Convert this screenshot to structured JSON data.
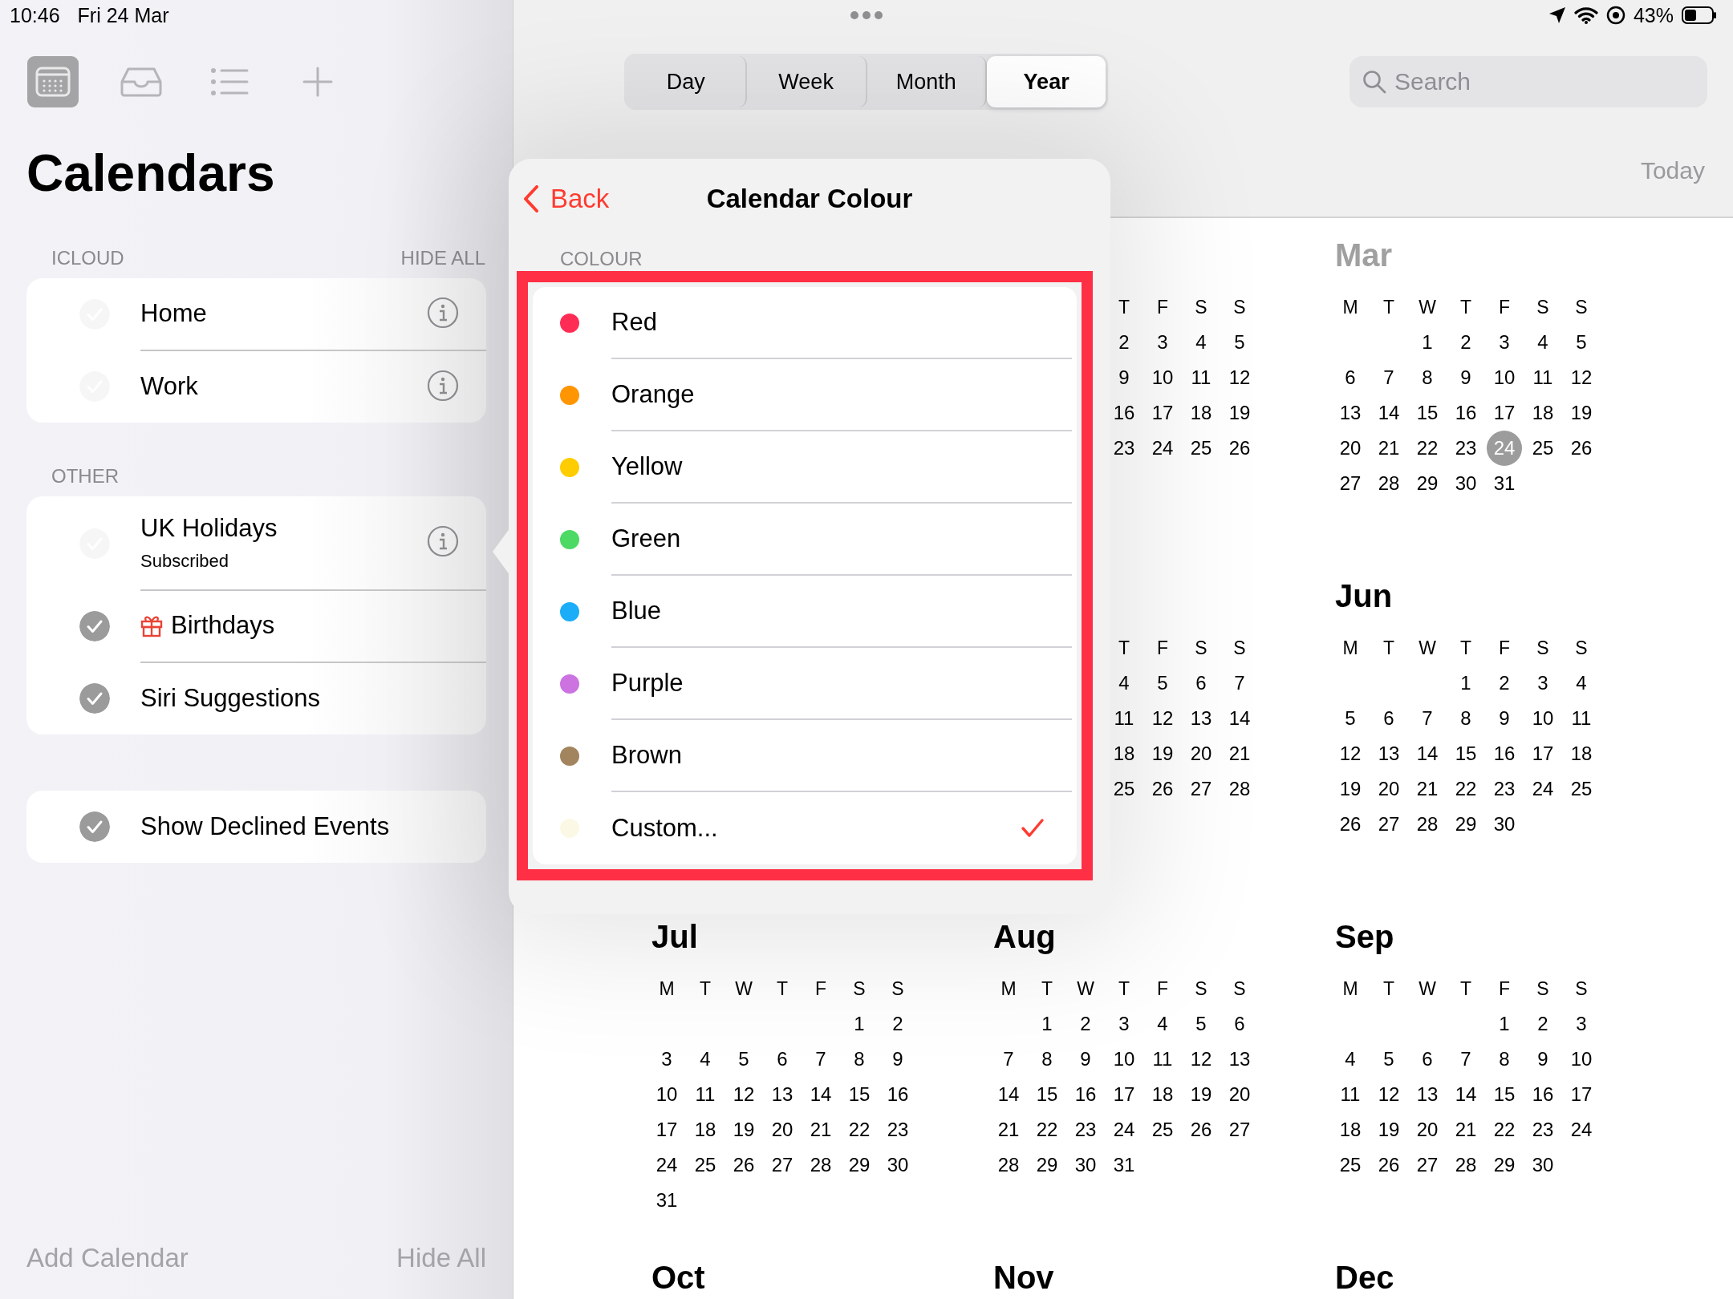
{
  "status_bar": {
    "time": "10:46",
    "date": "Fri 24 Mar",
    "battery": "43%"
  },
  "sidebar": {
    "toolbar": [
      {
        "kind": "calendar",
        "selected": true
      },
      {
        "kind": "inbox",
        "selected": false
      },
      {
        "kind": "list",
        "selected": false
      },
      {
        "kind": "add",
        "selected": false
      }
    ],
    "title": "Calendars",
    "sections": [
      {
        "label": "ICLOUD",
        "action": "HIDE ALL",
        "items": [
          {
            "name": "Home",
            "kind": "calendar",
            "checked": true,
            "color": "#f6f6f6",
            "info": true
          },
          {
            "name": "Work",
            "kind": "calendar",
            "checked": true,
            "color": "#f6f6f6",
            "info": true
          }
        ]
      },
      {
        "label": "OTHER",
        "items": [
          {
            "name": "UK Holidays",
            "subtitle": "Subscribed",
            "kind": "calendar",
            "checked": true,
            "color": "#f6f6f6",
            "info": true
          },
          {
            "name": "Birthdays",
            "kind": "birthday",
            "checked": true,
            "color": "#9b9b9b",
            "info": false
          },
          {
            "name": "Siri Suggestions",
            "kind": "calendar",
            "checked": true,
            "color": "#9b9b9b",
            "info": false
          }
        ]
      },
      {
        "items": [
          {
            "name": "Show Declined Events",
            "kind": "calendar",
            "checked": true,
            "color": "#9b9b9b",
            "info": false
          }
        ]
      }
    ],
    "footer": {
      "add": "Add Calendar",
      "hide": "Hide All"
    }
  },
  "main": {
    "views": [
      {
        "label": "Day",
        "selected": false
      },
      {
        "label": "Week",
        "selected": false
      },
      {
        "label": "Month",
        "selected": false
      },
      {
        "label": "Year",
        "selected": true
      }
    ],
    "search": {
      "placeholder": "Search"
    },
    "today": "Today",
    "month_rows": [
      [
        {
          "kind": "clipped",
          "weekdays": [
            "T",
            "F",
            "S",
            "S"
          ],
          "weeks": [
            [
              "2",
              "3",
              "4",
              "5"
            ],
            [
              "9",
              "10",
              "11",
              "12"
            ],
            [
              "16",
              "17",
              "18",
              "19"
            ],
            [
              "23",
              "24",
              "25",
              "26"
            ]
          ]
        },
        {
          "kind": "full",
          "title": "Mar",
          "current": true,
          "weekdays": [
            "M",
            "T",
            "W",
            "T",
            "F",
            "S",
            "S"
          ],
          "weeks": [
            [
              "1",
              "2",
              "3",
              "4",
              "5"
            ],
            [
              "6",
              "7",
              "8",
              "9",
              "10",
              "11",
              "12"
            ],
            [
              "13",
              "14",
              "15",
              "16",
              "17",
              "18",
              "19"
            ],
            [
              "20",
              "21",
              "22",
              "23",
              {
                "label": "24",
                "today": true
              },
              "25",
              "26"
            ],
            [
              "27",
              "28",
              "29",
              "30",
              "31"
            ]
          ]
        }
      ],
      [
        {
          "kind": "clipped",
          "weekdays": [
            "T",
            "F",
            "S",
            "S"
          ],
          "weeks": [
            [
              "4",
              "5",
              "6",
              "7"
            ],
            [
              "11",
              "12",
              "13",
              "14"
            ],
            [
              "18",
              "19",
              "20",
              "21"
            ],
            [
              "25",
              "26",
              "27",
              "28"
            ]
          ]
        },
        {
          "kind": "full",
          "title": "Jun",
          "current": false,
          "weekdays": [
            "M",
            "T",
            "W",
            "T",
            "F",
            "S",
            "S"
          ],
          "weeks": [
            [
              "1",
              "2",
              "3",
              "4"
            ],
            [
              "5",
              "6",
              "7",
              "8",
              "9",
              "10",
              "11"
            ],
            [
              "12",
              "13",
              "14",
              "15",
              "16",
              "17",
              "18"
            ],
            [
              "19",
              "20",
              "21",
              "22",
              "23",
              "24",
              "25"
            ],
            [
              "26",
              "27",
              "28",
              "29",
              "30"
            ]
          ]
        }
      ],
      [
        {
          "kind": "full",
          "title": "Jul",
          "current": false,
          "weekdays": [
            "M",
            "T",
            "W",
            "T",
            "F",
            "S",
            "S"
          ],
          "weeks": [
            [
              "1",
              "2"
            ],
            [
              "3",
              "4",
              "5",
              "6",
              "7",
              "8",
              "9"
            ],
            [
              "10",
              "11",
              "12",
              "13",
              "14",
              "15",
              "16"
            ],
            [
              "17",
              "18",
              "19",
              "20",
              "21",
              "22",
              "23"
            ],
            [
              "24",
              "25",
              "26",
              "27",
              "28",
              "29",
              "30"
            ],
            [
              "31"
            ]
          ]
        },
        {
          "kind": "full",
          "title": "Aug",
          "current": false,
          "weekdays": [
            "M",
            "T",
            "W",
            "T",
            "F",
            "S",
            "S"
          ],
          "weeks": [
            [
              "1",
              "2",
              "3",
              "4",
              "5",
              "6"
            ],
            [
              "7",
              "8",
              "9",
              "10",
              "11",
              "12",
              "13"
            ],
            [
              "14",
              "15",
              "16",
              "17",
              "18",
              "19",
              "20"
            ],
            [
              "21",
              "22",
              "23",
              "24",
              "25",
              "26",
              "27"
            ],
            [
              "28",
              "29",
              "30",
              "31"
            ]
          ]
        },
        {
          "kind": "full",
          "title": "Sep",
          "current": false,
          "weekdays": [
            "M",
            "T",
            "W",
            "T",
            "F",
            "S",
            "S"
          ],
          "weeks": [
            [
              "1",
              "2",
              "3"
            ],
            [
              "4",
              "5",
              "6",
              "7",
              "8",
              "9",
              "10"
            ],
            [
              "11",
              "12",
              "13",
              "14",
              "15",
              "16",
              "17"
            ],
            [
              "18",
              "19",
              "20",
              "21",
              "22",
              "23",
              "24"
            ],
            [
              "25",
              "26",
              "27",
              "28",
              "29",
              "30"
            ]
          ]
        }
      ],
      [
        {
          "kind": "full",
          "title": "Oct",
          "current": false
        },
        {
          "kind": "full",
          "title": "Nov",
          "current": false
        },
        {
          "kind": "full",
          "title": "Dec",
          "current": false
        }
      ]
    ]
  },
  "popover": {
    "back": "Back",
    "title": "Calendar Colour",
    "section": "COLOUR",
    "highlight_frame": true,
    "colours": [
      {
        "name": "Red",
        "color": "#ff2d55",
        "selected": false
      },
      {
        "name": "Orange",
        "color": "#ff9500",
        "selected": false
      },
      {
        "name": "Yellow",
        "color": "#ffcc00",
        "selected": false
      },
      {
        "name": "Green",
        "color": "#4cd964",
        "selected": false
      },
      {
        "name": "Blue",
        "color": "#1badf8",
        "selected": false
      },
      {
        "name": "Purple",
        "color": "#cc73e1",
        "selected": false
      },
      {
        "name": "Brown",
        "color": "#a2845e",
        "selected": false
      },
      {
        "name": "Custom...",
        "color": "#fbf9e6",
        "selected": true
      }
    ]
  }
}
